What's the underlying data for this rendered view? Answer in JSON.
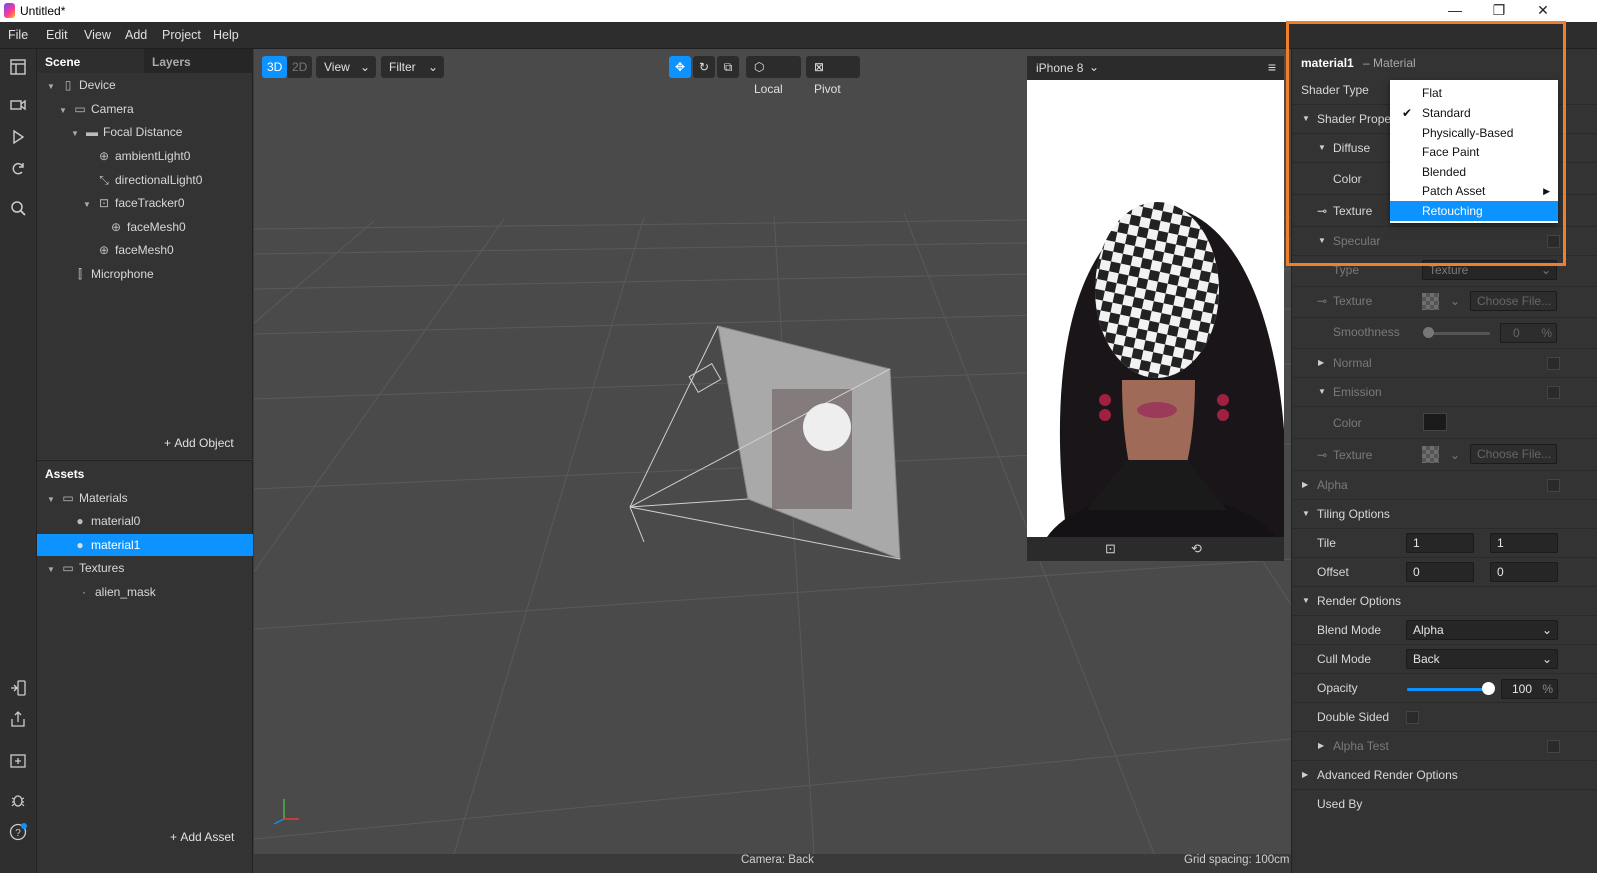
{
  "window": {
    "title": "Untitled*",
    "minimize": "—",
    "maximize": "❐",
    "close": "✕"
  },
  "menu": [
    "File",
    "Edit",
    "View",
    "Add",
    "Project",
    "Help"
  ],
  "scene_panel": {
    "tabs": [
      "Scene",
      "Layers"
    ],
    "tree": [
      {
        "label": "Device"
      },
      {
        "label": "Camera"
      },
      {
        "label": "Focal Distance"
      },
      {
        "label": "ambientLight0"
      },
      {
        "label": "directionalLight0"
      },
      {
        "label": "faceTracker0"
      },
      {
        "label": "faceMesh0"
      },
      {
        "label": "faceMesh0"
      },
      {
        "label": "Microphone"
      }
    ],
    "add_object": "Add Object"
  },
  "assets_panel": {
    "title": "Assets",
    "tree": [
      {
        "label": "Materials"
      },
      {
        "label": "material0"
      },
      {
        "label": "material1",
        "selected": true
      },
      {
        "label": "Textures"
      },
      {
        "label": "alien_mask"
      }
    ],
    "add_asset": "Add Asset"
  },
  "viewport": {
    "toolbar": {
      "mode_3d": "3D",
      "mode_2d": "2D",
      "view": "View",
      "filter": "Filter",
      "local": "Local",
      "pivot": "Pivot"
    },
    "status_camera": "Camera: Back",
    "status_grid": "Grid spacing: 100cm"
  },
  "preview": {
    "device": "iPhone 8"
  },
  "inspector": {
    "name": "material1",
    "type": "– Material",
    "shader_type_label": "Shader Type",
    "shader_properties": "Shader Properti",
    "diffuse": "Diffuse",
    "color": "Color",
    "texture": "Texture",
    "specular": "Specular",
    "type_label": "Type",
    "type_value": "Texture",
    "texture2": "Texture",
    "choose_file": "Choose File...",
    "smoothness": "Smoothness",
    "smoothness_value": "0",
    "percent": "%",
    "normal": "Normal",
    "emission": "Emission",
    "emission_color": "Color",
    "emission_texture": "Texture",
    "alpha": "Alpha",
    "tiling_options": "Tiling Options",
    "tile": "Tile",
    "tile_x": "1",
    "tile_y": "1",
    "offset": "Offset",
    "offset_x": "0",
    "offset_y": "0",
    "render_options": "Render Options",
    "blend_mode": "Blend Mode",
    "blend_mode_value": "Alpha",
    "cull_mode": "Cull Mode",
    "cull_mode_value": "Back",
    "opacity": "Opacity",
    "opacity_value": "100",
    "opacity_level": 1.0,
    "double_sided": "Double Sided",
    "alpha_test": "Alpha Test",
    "advanced_render_options": "Advanced Render Options",
    "used_by": "Used By"
  },
  "shader_menu": {
    "items": [
      "Flat",
      "Standard",
      "Physically-Based",
      "Face Paint",
      "Blended",
      "Patch Asset",
      "Retouching"
    ],
    "checked": "Standard",
    "highlighted": "Retouching"
  },
  "colors": {
    "accent": "#0d93ff",
    "highlight_box": "#f07f2a"
  }
}
